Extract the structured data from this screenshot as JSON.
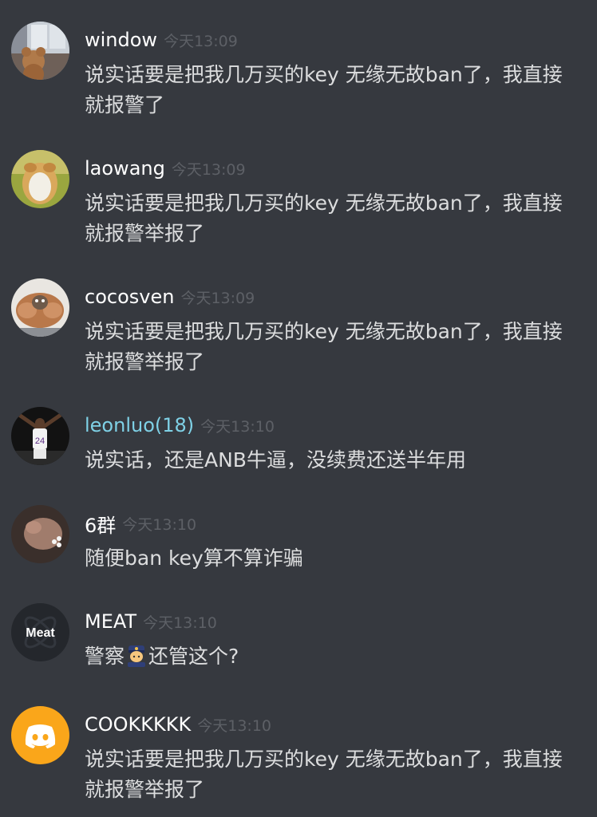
{
  "messages": [
    {
      "username": "window",
      "username_color": "#ffffff",
      "timestamp": "今天13:09",
      "text": "说实话要是把我几万买的key 无缘无故ban了，我直接就报警了",
      "avatar_icon": "bear-plush-window-photo"
    },
    {
      "username": "laowang",
      "username_color": "#ffffff",
      "timestamp": "今天13:09",
      "text": "说实话要是把我几万买的key 无缘无故ban了，我直接就报警举报了",
      "avatar_icon": "dog-back-photo"
    },
    {
      "username": "cocosven",
      "username_color": "#ffffff",
      "timestamp": "今天13:09",
      "text": "说实话要是把我几万买的key 无缘无故ban了，我直接就报警举报了",
      "avatar_icon": "muscular-cat-photo"
    },
    {
      "username": "leonluo(18)",
      "username_color": "#7fd1e6",
      "timestamp": "今天13:10",
      "text": "说实话，还是ANB牛逼，没续费还送半年用",
      "avatar_icon": "basketball-player-24-photo",
      "avatar_jersey": "24"
    },
    {
      "username": "6群",
      "username_color": "#ffffff",
      "timestamp": "今天13:10",
      "text": "随便ban key算不算诈骗",
      "avatar_icon": "hand-photo"
    },
    {
      "username": "MEAT",
      "username_color": "#ffffff",
      "timestamp": "今天13:10",
      "text_before": "警察",
      "emoji": "police-officer-emoji",
      "text_after": "还管这个?",
      "avatar_icon": "meat-logo",
      "avatar_label": "Meat"
    },
    {
      "username": "COOKKKKK",
      "username_color": "#ffffff",
      "timestamp": "今天13:10",
      "text": "说实话要是把我几万买的key 无缘无故ban了，我直接就报警举报了",
      "avatar_icon": "discord-default-avatar-icon"
    }
  ],
  "colors": {
    "background": "#36393f",
    "text": "#dcddde",
    "timestamp": "#5d6066",
    "discord_orange": "#faa61a"
  }
}
